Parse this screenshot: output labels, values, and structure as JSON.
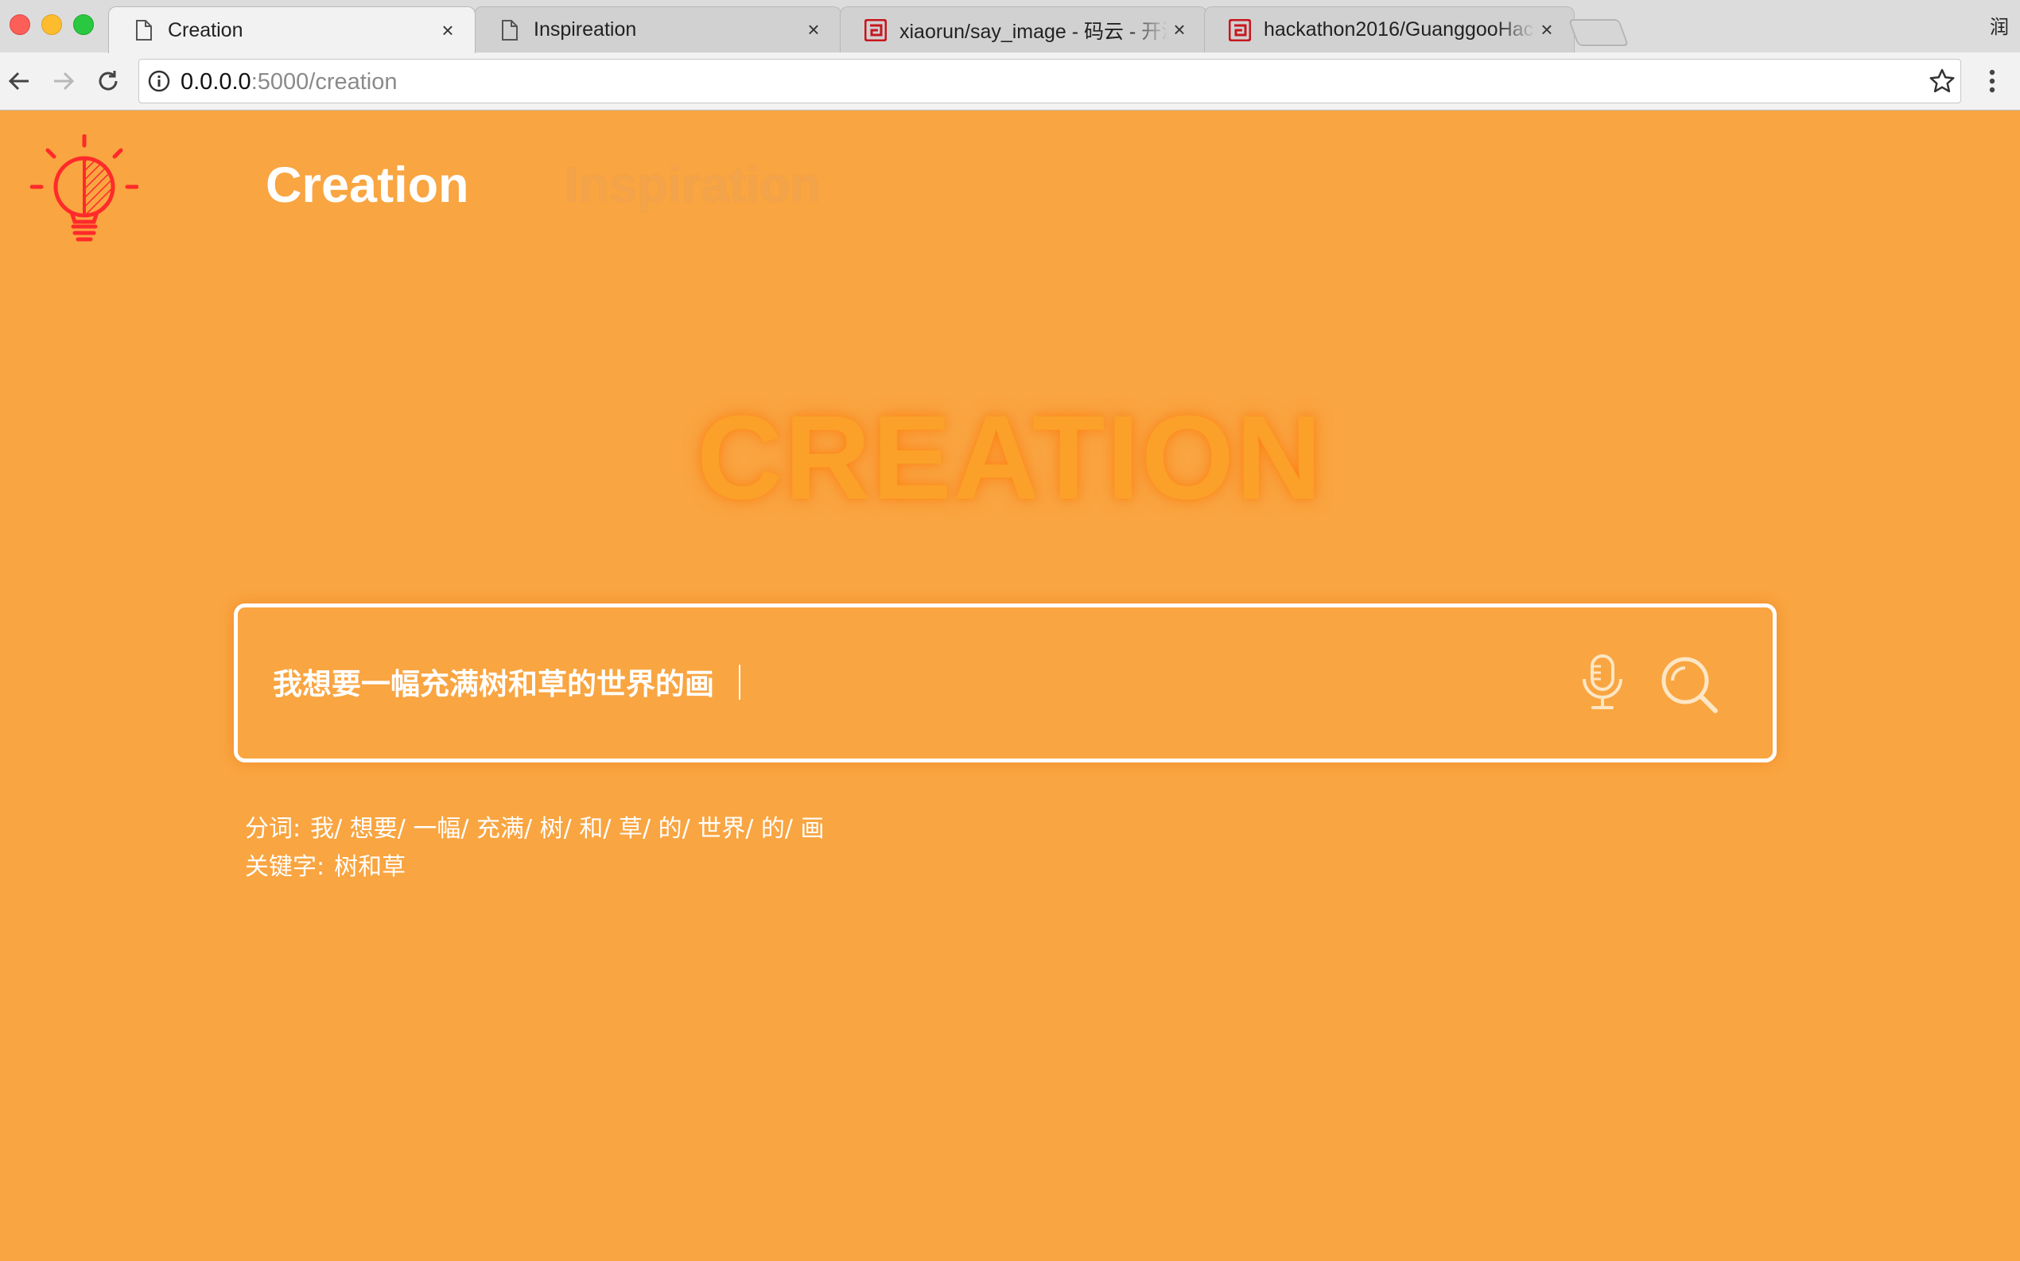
{
  "browser": {
    "tabs": [
      {
        "title": "Creation",
        "icon": "document-icon",
        "active": true
      },
      {
        "title": "Inspireation",
        "icon": "document-icon",
        "active": false
      },
      {
        "title": "xiaorun/say_image - 码云 - 开源",
        "icon": "gitee-icon",
        "active": false
      },
      {
        "title": "hackathon2016/GuanggooHac",
        "icon": "gitee-icon",
        "active": false
      }
    ],
    "window_char": "润",
    "url_host": "0.0.0.0",
    "url_path": ":5000/creation"
  },
  "nav": {
    "creation_label": "Creation",
    "inspiration_label": "Inspiration"
  },
  "hero": {
    "title": "CREATION"
  },
  "search": {
    "value": "我想要一幅充满树和草的世界的画",
    "placeholder": ""
  },
  "analysis": {
    "segmentation_label": "分词:",
    "segmentation_value": "我/ 想要/ 一幅/ 充满/ 树/ 和/ 草/ 的/ 世界/ 的/ 画",
    "keyword_label": "关键字:",
    "keyword_value": "树和草"
  },
  "colors": {
    "page_background": "#f9a541",
    "logo_red": "#ff2a2a",
    "text_white": "#ffffff"
  }
}
